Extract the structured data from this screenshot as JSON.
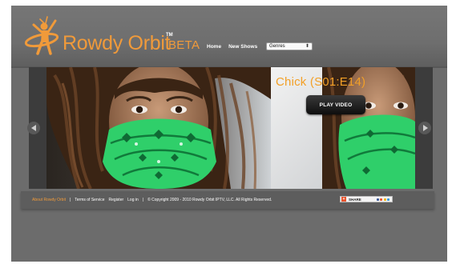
{
  "brand": {
    "name": "Rowdy Orbit",
    "tm": "TM",
    "beta": "BETA"
  },
  "nav": {
    "home": "Home",
    "new_shows": "New Shows",
    "genres_select": "Genres"
  },
  "carousel": {
    "title": "Chick (S01:E14)",
    "play_label": "PLAY VIDEO"
  },
  "footer": {
    "about": "About Rowdy Orbit",
    "sep": "|",
    "terms": "Terms of Service",
    "register": "Register",
    "login": "Log in",
    "copyright": "© Copyright 2009 - 2010 Rowdy Orbit IPTV, LLC. All Rights Reserved.",
    "share": "SHARE"
  },
  "colors": {
    "accent_orange": "#f09a3a",
    "title_orange": "#f3a027",
    "page_gray": "#6c6c6c",
    "bandana_green": "#2fcf6a"
  },
  "icons": {
    "prev": "chevron-left-icon",
    "next": "chevron-right-icon",
    "logo": "orbit-figure-logo"
  }
}
